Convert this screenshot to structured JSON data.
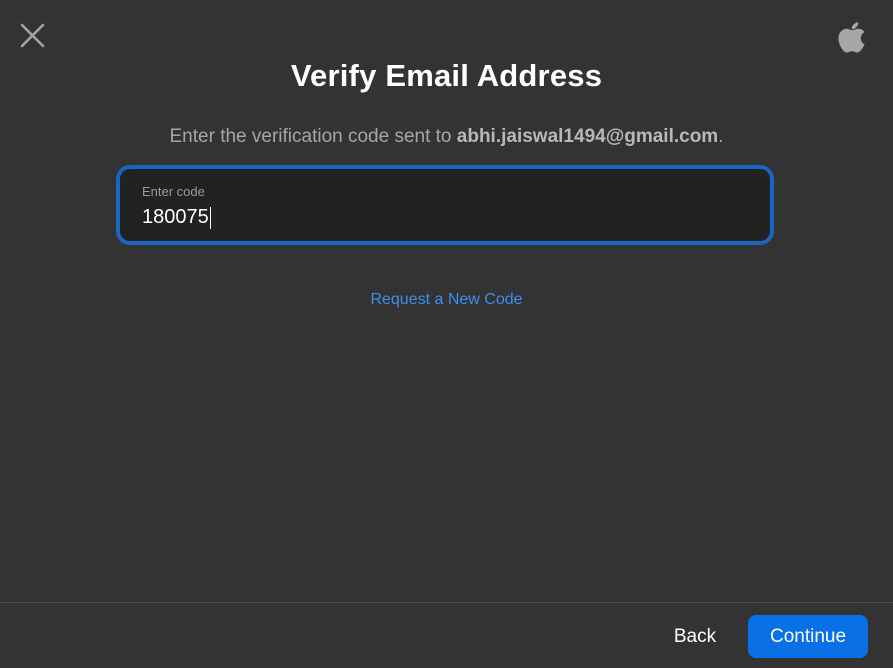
{
  "header": {
    "close_icon": "close-icon",
    "logo_icon": "apple-logo-icon",
    "title": "Verify Email Address"
  },
  "instructions": {
    "prefix": "Enter the verification code sent to ",
    "email": "abhi.jaiswal1494@gmail.com",
    "suffix": "."
  },
  "code_field": {
    "label": "Enter code",
    "value": "180075"
  },
  "request_link": "Request a New Code",
  "footer": {
    "back_label": "Back",
    "continue_label": "Continue"
  },
  "colors": {
    "background": "#333333",
    "field_border": "#1a64c2",
    "link": "#3b8ff0",
    "primary_button": "#0a70e6"
  }
}
